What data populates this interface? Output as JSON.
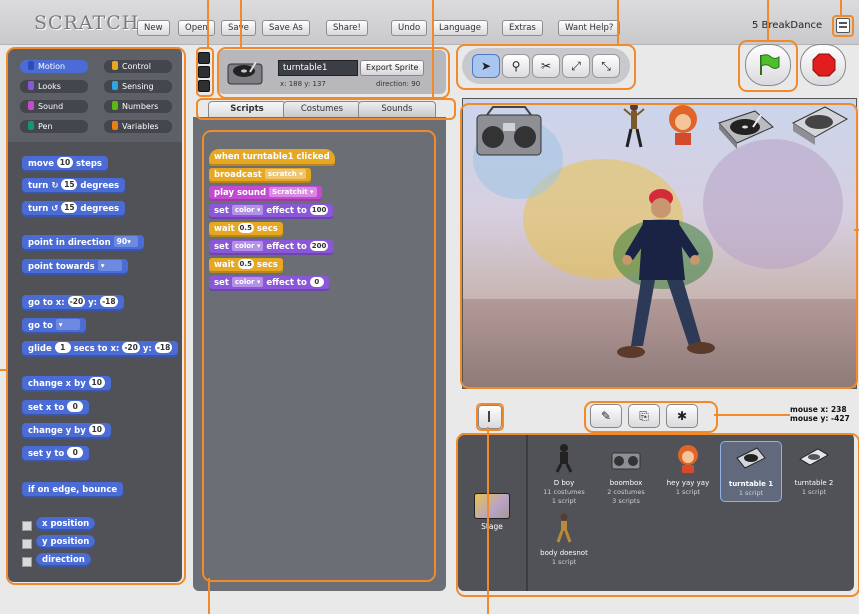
{
  "app": {
    "logo": "SCRATCH",
    "project_name": "5 BreakDance"
  },
  "toolbar": {
    "buttons": [
      {
        "label": "New"
      },
      {
        "label": "Open"
      },
      {
        "label": "Save"
      },
      {
        "label": "Save As"
      },
      {
        "label": "Share!"
      },
      {
        "label": "Undo"
      },
      {
        "label": "Language"
      },
      {
        "label": "Extras"
      },
      {
        "label": "Want Help?"
      }
    ]
  },
  "palette": {
    "categories": [
      {
        "label": "Motion",
        "color": "#4a6cd4",
        "selected": true
      },
      {
        "label": "Control",
        "color": "#e6a823"
      },
      {
        "label": "Looks",
        "color": "#8a57d8"
      },
      {
        "label": "Sensing",
        "color": "#2ca5e2"
      },
      {
        "label": "Sound",
        "color": "#c44bd1"
      },
      {
        "label": "Numbers",
        "color": "#5cb712"
      },
      {
        "label": "Pen",
        "color": "#0e9a6c"
      },
      {
        "label": "Variables",
        "color": "#ee7d16"
      }
    ],
    "blocks": {
      "move": {
        "a": "move",
        "v": "10",
        "b": "steps"
      },
      "turn_cw": {
        "a": "turn ↻",
        "v": "15",
        "b": "degrees"
      },
      "turn_ccw": {
        "a": "turn ↺",
        "v": "15",
        "b": "degrees"
      },
      "point_dir": {
        "a": "point in direction",
        "v": "90▾"
      },
      "point_towards": {
        "a": "point towards",
        "v": "▾"
      },
      "go_to_xy": {
        "a": "go to x:",
        "x": "-20",
        "b": "y:",
        "y": "-18"
      },
      "go_to": {
        "a": "go to",
        "v": "▾"
      },
      "glide": {
        "a": "glide",
        "s": "1",
        "b": "secs to x:",
        "x": "-20",
        "c": "y:",
        "y": "-18"
      },
      "change_x": {
        "a": "change x by",
        "v": "10"
      },
      "set_x": {
        "a": "set x to",
        "v": "0"
      },
      "change_y": {
        "a": "change y by",
        "v": "10"
      },
      "set_y": {
        "a": "set y to",
        "v": "0"
      },
      "bounce": {
        "a": "if on edge, bounce"
      },
      "x_position": "x position",
      "y_position": "y position",
      "direction": "direction"
    }
  },
  "sprite_info": {
    "name": "turntable1",
    "export_label": "Export Sprite",
    "coords": "x: 188  y: 137",
    "direction": "direction: 90"
  },
  "tabs": [
    {
      "label": "Scripts",
      "active": true
    },
    {
      "label": "Costumes"
    },
    {
      "label": "Sounds"
    }
  ],
  "script": {
    "hat": "when turntable1 clicked",
    "broadcast": {
      "a": "broadcast",
      "v": "scratch ▾"
    },
    "play_sound": {
      "a": "play sound",
      "v": "Scratchit ▾"
    },
    "set_effect1": {
      "a": "set",
      "v": "color ▾",
      "b": "effect to",
      "n": "100"
    },
    "wait1": {
      "a": "wait",
      "v": "0.5",
      "b": "secs"
    },
    "set_effect2": {
      "a": "set",
      "v": "color ▾",
      "b": "effect to",
      "n": "200"
    },
    "wait2": {
      "a": "wait",
      "v": "0.5",
      "b": "secs"
    },
    "set_effect3": {
      "a": "set",
      "v": "color ▾",
      "b": "effect to",
      "n": "0"
    }
  },
  "stage": {
    "mouse_x_label": "mouse x:",
    "mouse_x": "238",
    "mouse_y_label": "mouse y:",
    "mouse_y": "-427"
  },
  "sprites": [
    {
      "name": "D boy",
      "costumes": "11 costumes",
      "scripts": "1 script"
    },
    {
      "name": "boombox",
      "costumes": "2 costumes",
      "scripts": "3 scripts"
    },
    {
      "name": "hey yay yay",
      "costumes": "",
      "scripts": "1 script"
    },
    {
      "name": "turntable 1",
      "costumes": "",
      "scripts": "1 script",
      "selected": true
    },
    {
      "name": "turntable 2",
      "costumes": "",
      "scripts": "1 script"
    },
    {
      "name": "body doesnot",
      "costumes": "",
      "scripts": "1 script"
    }
  ],
  "stage_thumb_label": "Stage"
}
